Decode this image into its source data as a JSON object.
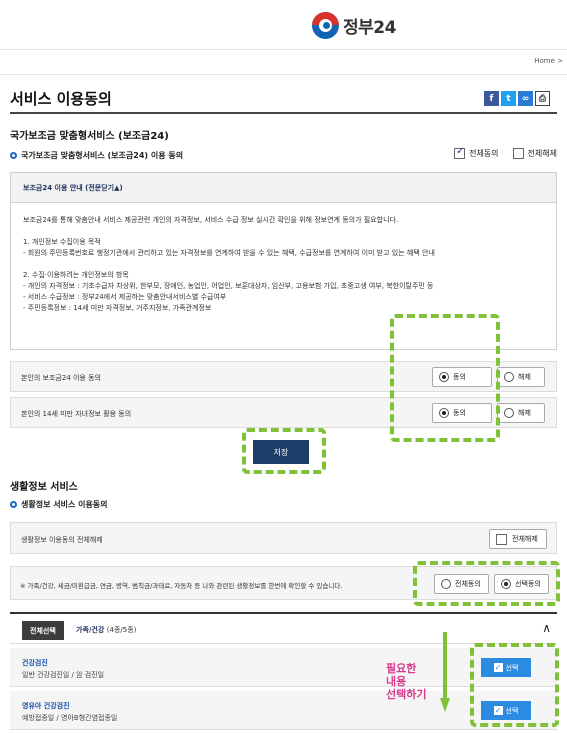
{
  "header": {
    "logo_text": "정부24"
  },
  "breadcrumb": {
    "text": "Home >"
  },
  "page": {
    "title": "서비스 이용동의",
    "share_icons": [
      "facebook-icon",
      "twitter-icon",
      "link-icon",
      "print-icon"
    ]
  },
  "section1": {
    "title": "국가보조금 맞춤형서비스 (보조금24)",
    "subtitle": "국가보조금 맞춤형서비스 (보조금24) 이용 동의",
    "all_agree": "전체동의",
    "all_cancel": "전체해제",
    "info_head": "보조금24 이용 안내  (전문닫기▲)",
    "info_lines": [
      "보조금24를 통해 맞춤안내 서비스 제공관련 개인의 자격정보, 서비스 수급 정보 실시간 확인을 위해 정보연계 동의가 필요합니다.",
      "",
      "1. 개인정보 수집이용 목적",
      " - 회원의 주민등록번호로 행정기관에서 관리하고 있는 자격정보를 연계하여 받을 수 있는 혜택, 수급정보를 연계하여 이미 받고 있는 혜택 안내",
      "",
      "2. 수집·이용하려는 개인정보의 항목",
      " - 개인의 자격정보 : 기초수급자 차상위, 한부모, 장애인, 농업인, 어업인, 보훈대상자, 임산부, 고용보험 가입, 초중고생 여부, 북한이탈주민 등",
      " - 서비스 수급정보 : 정부24에서 제공하는 맞춤안내서비스별 수급여부",
      " - 주민등록정보 : 14세 미만 자격정보, 거주지정보, 가족관계정보"
    ],
    "consent_rows": [
      {
        "label": "본인의 보조금24 이용 동의",
        "agree": "동의",
        "cancel": "해제"
      },
      {
        "label": "본인의 14세 미만 자녀정보 활용 동의",
        "agree": "동의",
        "cancel": "해제"
      }
    ],
    "save_label": "저장"
  },
  "section2": {
    "title": "생활정보 서비스",
    "subtitle": "생활정보 서비스 이용동의",
    "cancel_row_label": "생활정보 이용동의 전체해제",
    "cancel_all": "전체해제",
    "notice": "※ 가족/건강, 세금/미환급금, 연금, 병역, 범칙금/과태료, 자동차 등 나와 관련된 생활정보를 한번에 확인할 수 있습니다.",
    "all_agree": "전체동의",
    "select_agree": "선택동의",
    "category_tag": "전체선택",
    "category_name": "가족/건강",
    "category_count": "(4종/5종)",
    "services": [
      {
        "name": "건강검진",
        "desc": "일반 건강검진일 / 암 검진일",
        "btn": "선택"
      },
      {
        "name": "영유아 건강검진",
        "desc": "예방접종일 / 영아B형간염접종일",
        "btn": "선택"
      }
    ]
  },
  "annotation": {
    "line1": "필요한",
    "line2": "내용",
    "line3": "선택하기"
  },
  "colors": {
    "dashed_highlight": "#7fc23a",
    "annotation_text": "#d93a8c",
    "save_button": "#1d3c68",
    "select_button": "#2b8be0"
  }
}
